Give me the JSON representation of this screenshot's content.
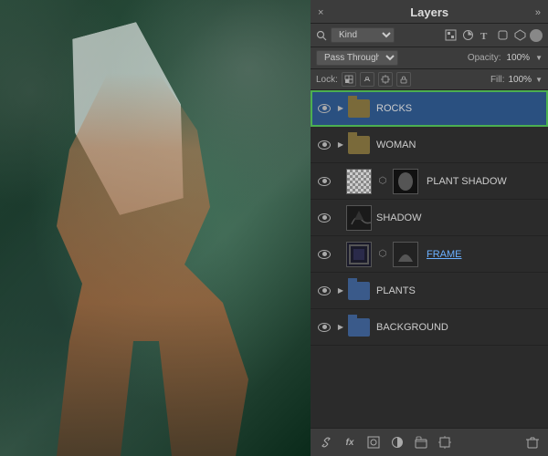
{
  "panel": {
    "title": "Layers",
    "close_label": "×",
    "expand_label": "»"
  },
  "filter_row": {
    "kind_label": "Kind",
    "filter_toggle_label": "●",
    "icons": [
      "image-icon",
      "adjustment-icon",
      "type-icon",
      "shape-icon",
      "smartobject-icon"
    ]
  },
  "blend_row": {
    "mode_label": "Pass Through",
    "opacity_label": "Opacity:",
    "opacity_value": "100%",
    "dropdown": "▼"
  },
  "lock_row": {
    "lock_label": "Lock:",
    "lock_icons": [
      "checkerboard-lock",
      "brush-lock",
      "move-lock",
      "artboard-lock"
    ],
    "fill_label": "Fill:",
    "fill_value": "100%",
    "dropdown": "▼"
  },
  "layers": [
    {
      "name": "ROCKS",
      "type": "group",
      "folder_color": "brown",
      "visible": true,
      "selected": true,
      "linked": false,
      "has_mask": false
    },
    {
      "name": "WOMAN",
      "type": "group",
      "folder_color": "brown",
      "visible": true,
      "selected": false,
      "linked": false,
      "has_mask": false
    },
    {
      "name": "PLANT SHADOW",
      "type": "layer",
      "folder_color": null,
      "visible": true,
      "selected": false,
      "linked": true,
      "has_mask": true,
      "thumb_type": "checker"
    },
    {
      "name": "SHADOW",
      "type": "layer",
      "folder_color": null,
      "visible": true,
      "selected": false,
      "linked": false,
      "has_mask": false,
      "thumb_type": "shadow"
    },
    {
      "name": "FRAME",
      "type": "layer",
      "folder_color": null,
      "visible": true,
      "selected": false,
      "linked": true,
      "has_mask": true,
      "thumb_type": "frame",
      "is_link": true
    },
    {
      "name": "PLANTS",
      "type": "group",
      "folder_color": "blue",
      "visible": true,
      "selected": false,
      "linked": false,
      "has_mask": false
    },
    {
      "name": "BACKGROUND",
      "type": "group",
      "folder_color": "blue",
      "visible": true,
      "selected": false,
      "linked": false,
      "has_mask": false
    }
  ],
  "bottom_toolbar": {
    "link_label": "🔗",
    "fx_label": "fx",
    "mask_label": "⬜",
    "adjustment_label": "◐",
    "folder_label": "📁",
    "artboard_label": "⬛",
    "delete_label": "🗑"
  }
}
